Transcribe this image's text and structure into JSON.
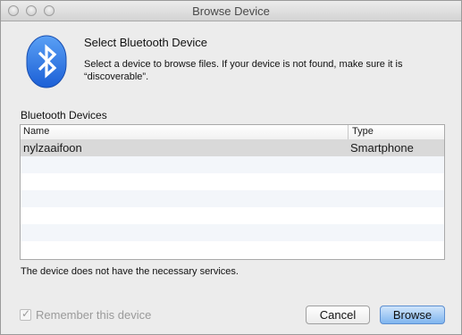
{
  "window": {
    "title": "Browse Device"
  },
  "header": {
    "heading": "Select Bluetooth Device",
    "description": "Select a device to browse files.  If your device is not found, make sure it is “discoverable”."
  },
  "devices": {
    "section_label": "Bluetooth Devices",
    "columns": {
      "name": "Name",
      "type": "Type"
    },
    "rows": [
      {
        "name": "nylzaaifoon",
        "type": "Smartphone",
        "selected": true
      }
    ]
  },
  "status_text": "The device does not have the necessary services.",
  "remember": {
    "label": "Remember this device",
    "checked": true,
    "enabled": false
  },
  "buttons": {
    "cancel": "Cancel",
    "browse": "Browse"
  },
  "colors": {
    "bluetooth_blue": "#2a73e8",
    "default_button": "#7fb5ef"
  },
  "icons": {
    "app_icon": "bluetooth-icon",
    "check": "checkmark-icon"
  }
}
